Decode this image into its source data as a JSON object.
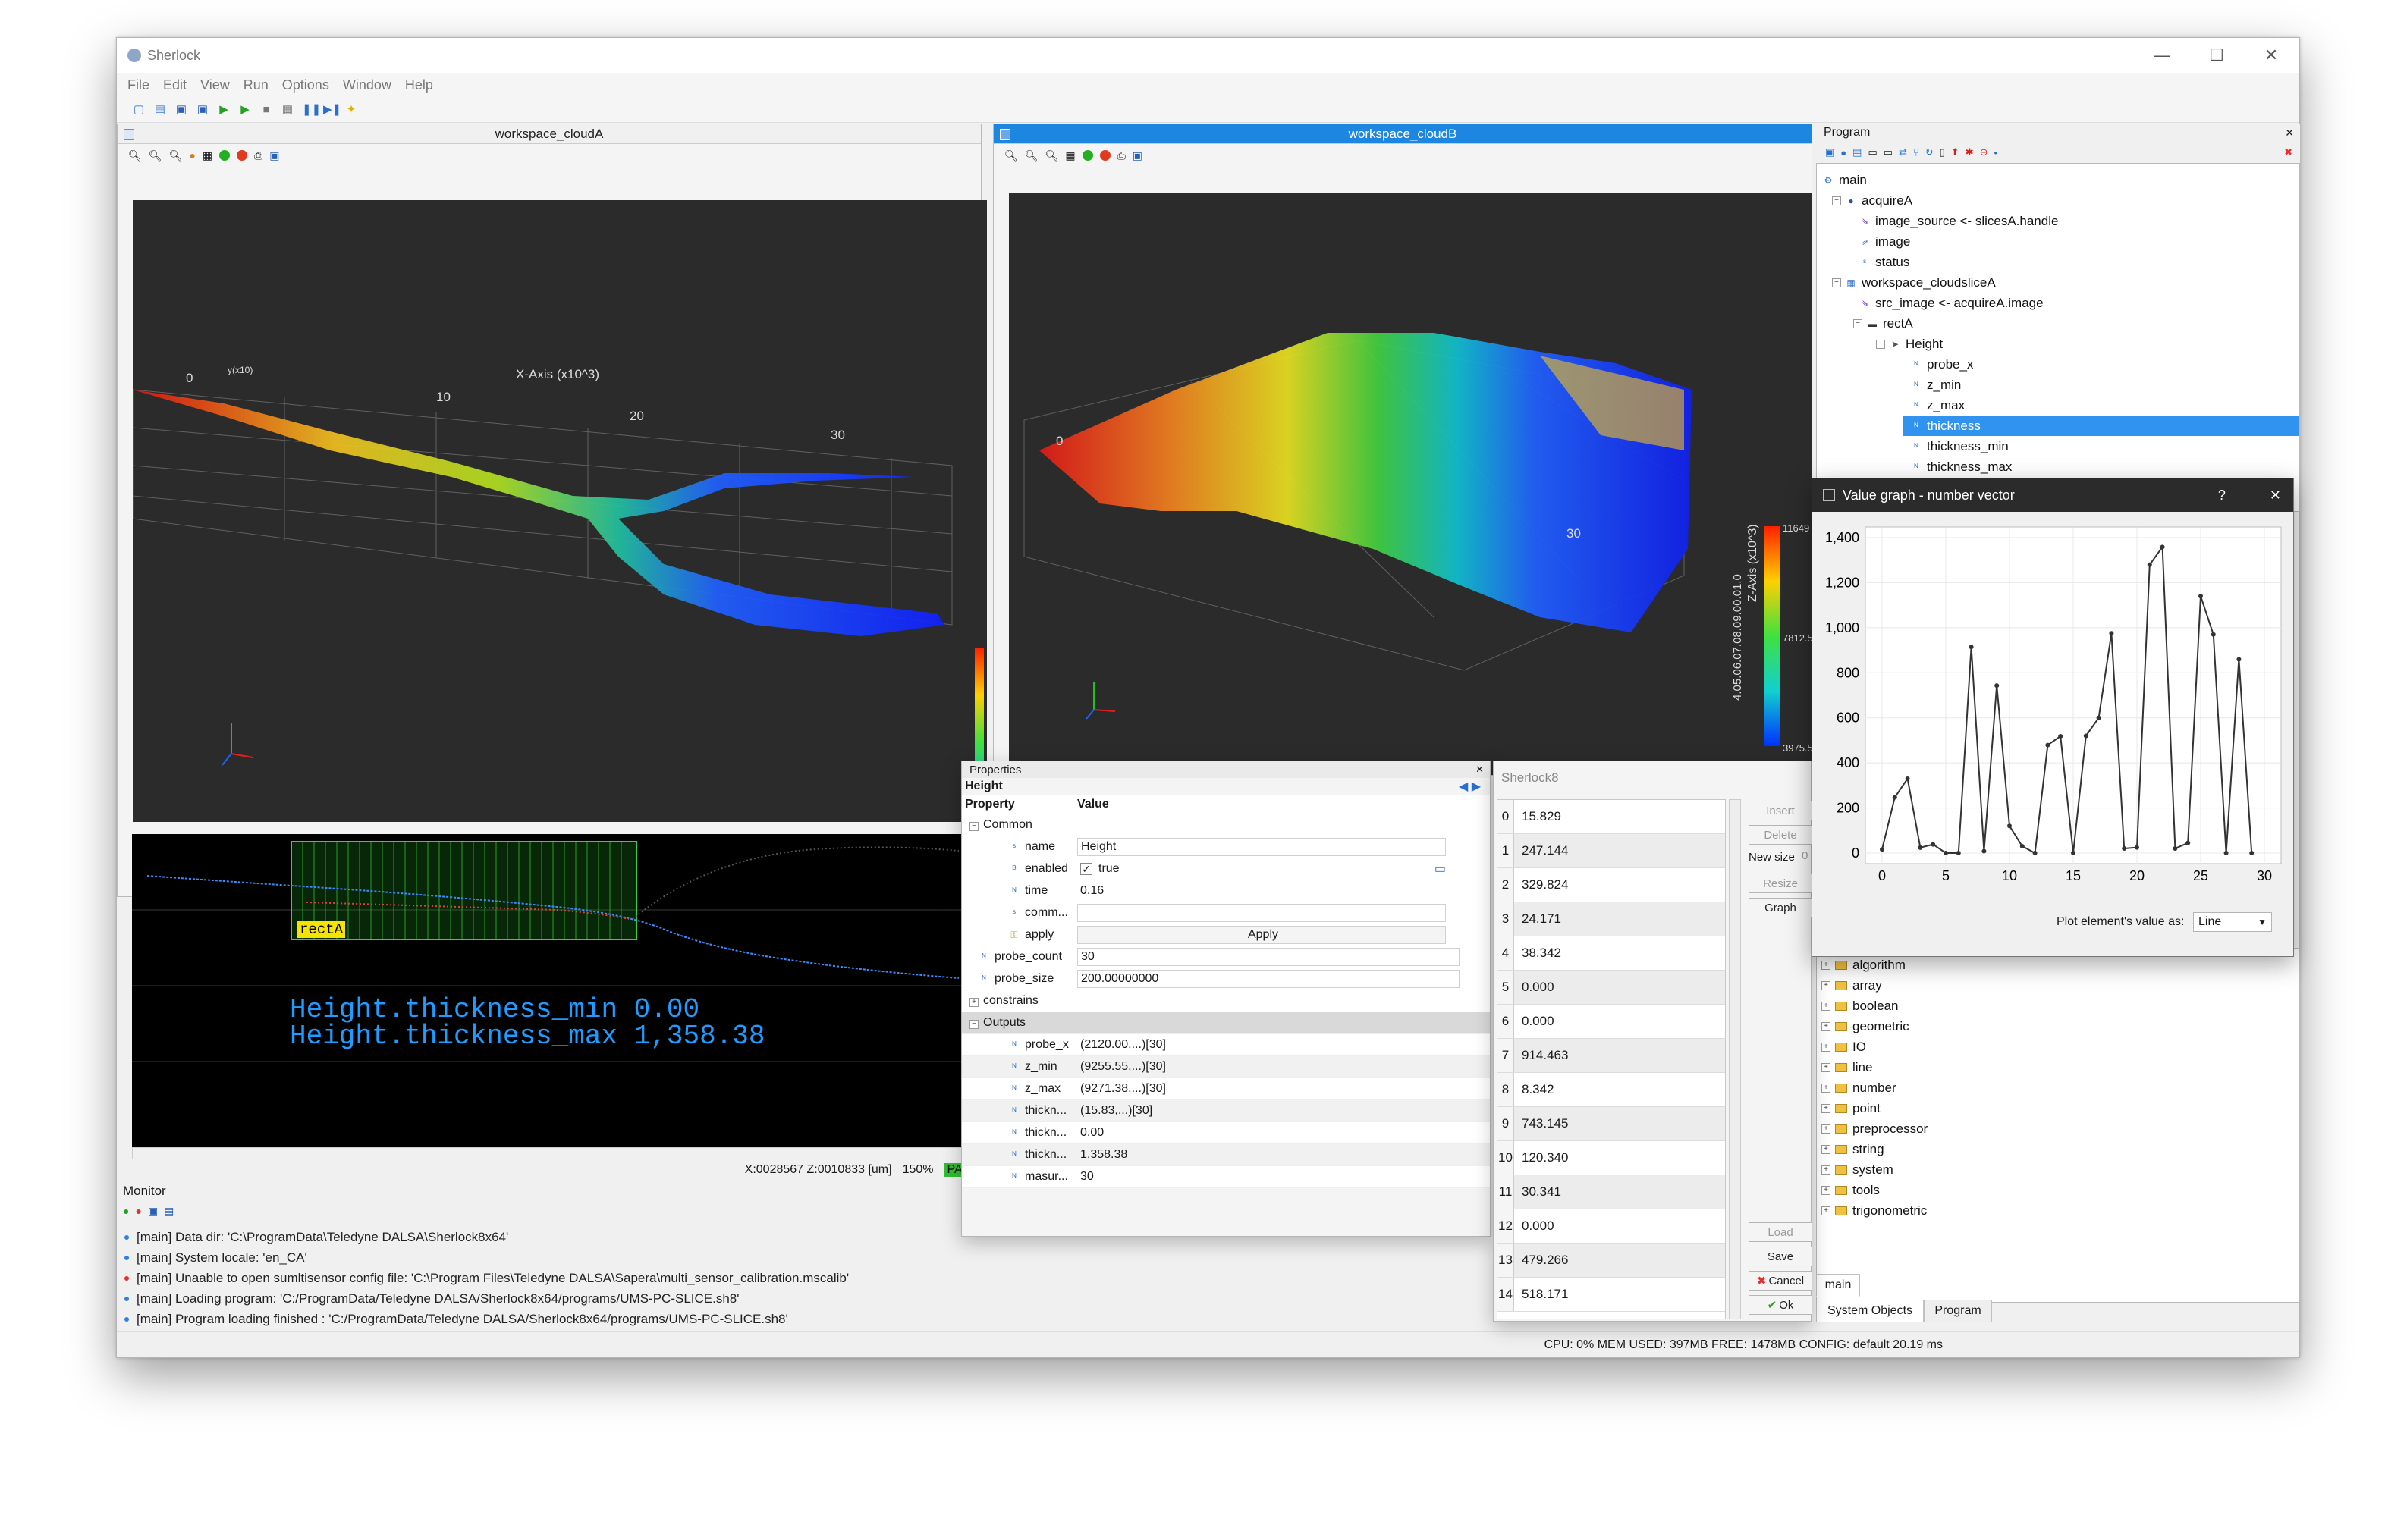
{
  "app": {
    "title": "Sherlock",
    "menu": [
      "File",
      "Edit",
      "View",
      "Run",
      "Options",
      "Window",
      "Help"
    ]
  },
  "colors": {
    "accent": "#1c86e0",
    "selection": "#2f93ef",
    "view_bg": "#2b2b2b",
    "overlay_text": "#1f9cff",
    "roi_green": "#3ecf3e",
    "pass_green": "#2fbf2f"
  },
  "workspaceA": {
    "title": "workspace_cloudA",
    "axis_x_label": "X-Axis (x10^3)",
    "ticks": [
      "0",
      "10",
      "20",
      "30"
    ],
    "small_label": "y(x10)"
  },
  "workspaceB": {
    "title": "workspace_cloudB",
    "axis_z_label": "Z-Axis (x10^3)",
    "tick0": "0",
    "tick30": "30",
    "z_ticks": "4.05.06.07.08.09.00.01.0",
    "scale_top": "11649",
    "scale_mid": "7812.5",
    "scale_bottom": "3975.5"
  },
  "slice": {
    "roi_label": "rectA",
    "overlay1": "Height.thickness_min 0.00",
    "overlay2": "Height.thickness_max 1,358.38",
    "status": "X:0028567 Z:0010833 [um]",
    "zoom": "150%",
    "pass": "PASS"
  },
  "program": {
    "title": "Program",
    "tree": [
      {
        "label": "main",
        "level": 0
      },
      {
        "label": "acquireA",
        "level": 1
      },
      {
        "label": "image_source <- slicesA.handle",
        "level": 2
      },
      {
        "label": "image",
        "level": 2
      },
      {
        "label": "status",
        "level": 2
      },
      {
        "label": "workspace_cloudsliceA",
        "level": 1
      },
      {
        "label": "src_image <- acquireA.image",
        "level": 2
      },
      {
        "label": "rectA",
        "level": 2
      },
      {
        "label": "Height",
        "level": 3
      },
      {
        "label": "probe_x",
        "level": 4
      },
      {
        "label": "z_min",
        "level": 4
      },
      {
        "label": "z_max",
        "level": 4
      },
      {
        "label": "thickness",
        "level": 4,
        "selected": true
      },
      {
        "label": "thickness_min",
        "level": 4
      },
      {
        "label": "thickness_max",
        "level": 4
      }
    ]
  },
  "value_graph": {
    "title": "Value graph - number vector",
    "help": "?",
    "close": "✕",
    "plot_label": "Plot element's value as:",
    "plot_mode": "Line"
  },
  "chart_data": {
    "type": "line",
    "x": [
      0,
      1,
      2,
      3,
      4,
      5,
      6,
      7,
      8,
      9,
      10,
      11,
      12,
      13,
      14,
      15,
      16,
      17,
      18,
      19,
      20,
      21,
      22,
      23,
      24,
      25,
      26,
      27,
      28,
      29
    ],
    "values": [
      15.829,
      247.144,
      329.824,
      24.171,
      38.342,
      0.0,
      0.0,
      914.463,
      8.342,
      743.145,
      120.34,
      30.341,
      0.0,
      479.266,
      518.171,
      0,
      520,
      600,
      975,
      20,
      25,
      1280,
      1358.38,
      20,
      45,
      1140,
      970,
      0,
      860,
      0
    ],
    "xticks": [
      "0",
      "5",
      "10",
      "15",
      "20",
      "25",
      "30"
    ],
    "yticks": [
      "0",
      "200",
      "400",
      "600",
      "800",
      "1,000",
      "1,200",
      "1,400"
    ],
    "xlim": [
      0,
      30
    ],
    "ylim": [
      0,
      1400
    ],
    "grid": true,
    "legend": "none"
  },
  "properties": {
    "title": "Properties",
    "object": "Height",
    "col_property": "Property",
    "col_value": "Value",
    "common_label": "Common",
    "constrains_label": "constrains",
    "outputs_label": "Outputs",
    "apply_button": "Apply",
    "rows": [
      {
        "name": "name",
        "value": "Height",
        "type": "S"
      },
      {
        "name": "enabled",
        "value": "true",
        "type": "B"
      },
      {
        "name": "time",
        "value": "0.16",
        "type": "N"
      },
      {
        "name": "comm...",
        "value": "",
        "type": "S"
      },
      {
        "name": "apply",
        "value": "Apply",
        "type": "A"
      }
    ],
    "params": [
      {
        "name": "probe_count",
        "value": "30"
      },
      {
        "name": "probe_size",
        "value": "200.00000000"
      }
    ],
    "outputs": [
      {
        "name": "probe_x",
        "value": "(2120.00,...)[30]"
      },
      {
        "name": "z_min",
        "value": "(9255.55,...)[30]"
      },
      {
        "name": "z_max",
        "value": "(9271.38,...)[30]"
      },
      {
        "name": "thickn...",
        "value": "(15.83,...)[30]"
      },
      {
        "name": "thickn...",
        "value": "0.00"
      },
      {
        "name": "thickn...",
        "value": "1,358.38"
      },
      {
        "name": "masur...",
        "value": "30"
      }
    ]
  },
  "vector_editor": {
    "title": "Sherlock8",
    "rows": [
      {
        "i": "0",
        "v": "15.829"
      },
      {
        "i": "1",
        "v": "247.144"
      },
      {
        "i": "2",
        "v": "329.824"
      },
      {
        "i": "3",
        "v": "24.171"
      },
      {
        "i": "4",
        "v": "38.342"
      },
      {
        "i": "5",
        "v": "0.000"
      },
      {
        "i": "6",
        "v": "0.000"
      },
      {
        "i": "7",
        "v": "914.463"
      },
      {
        "i": "8",
        "v": "8.342"
      },
      {
        "i": "9",
        "v": "743.145"
      },
      {
        "i": "10",
        "v": "120.340"
      },
      {
        "i": "11",
        "v": "30.341"
      },
      {
        "i": "12",
        "v": "0.000"
      },
      {
        "i": "13",
        "v": "479.266"
      },
      {
        "i": "14",
        "v": "518.171"
      }
    ],
    "buttons": {
      "insert": "Insert",
      "delete": "Delete",
      "new_size": "New size",
      "new_size_value": "0",
      "resize": "Resize",
      "graph": "Graph",
      "load": "Load",
      "save": "Save",
      "cancel": "Cancel",
      "ok": "Ok"
    }
  },
  "system_objects": {
    "items": [
      "algorithm",
      "array",
      "boolean",
      "geometric",
      "IO",
      "line",
      "number",
      "point",
      "preprocessor",
      "string",
      "system",
      "tools",
      "trigonometric"
    ],
    "tab_main": "main",
    "tab_system": "System Objects",
    "tab_program": "Program"
  },
  "monitor": {
    "title": "Monitor",
    "lines": [
      {
        "text": "[main] Data dir: 'C:\\ProgramData\\Teledyne DALSA\\Sherlock8x64'",
        "color": "#2f7fe0"
      },
      {
        "text": "[main] System locale: 'en_CA'",
        "color": "#2f7fe0"
      },
      {
        "text": "[main] Unaable to open sumltisensor config file: 'C:\\Program Files\\Teledyne DALSA\\Sapera\\multi_sensor_calibration.mscalib'",
        "color": "#e03030"
      },
      {
        "text": "[main] Loading program: 'C:/ProgramData/Teledyne DALSA/Sherlock8x64/programs/UMS-PC-SLICE.sh8'",
        "color": "#2f7fe0"
      },
      {
        "text": "[main] Program loading finished : 'C:/ProgramData/Teledyne DALSA/Sherlock8x64/programs/UMS-PC-SLICE.sh8'",
        "color": "#2f7fe0"
      }
    ]
  },
  "statusbar": "CPU: 0% MEM USED: 397MB FREE: 1478MB CONFIG: default 20.19 ms"
}
